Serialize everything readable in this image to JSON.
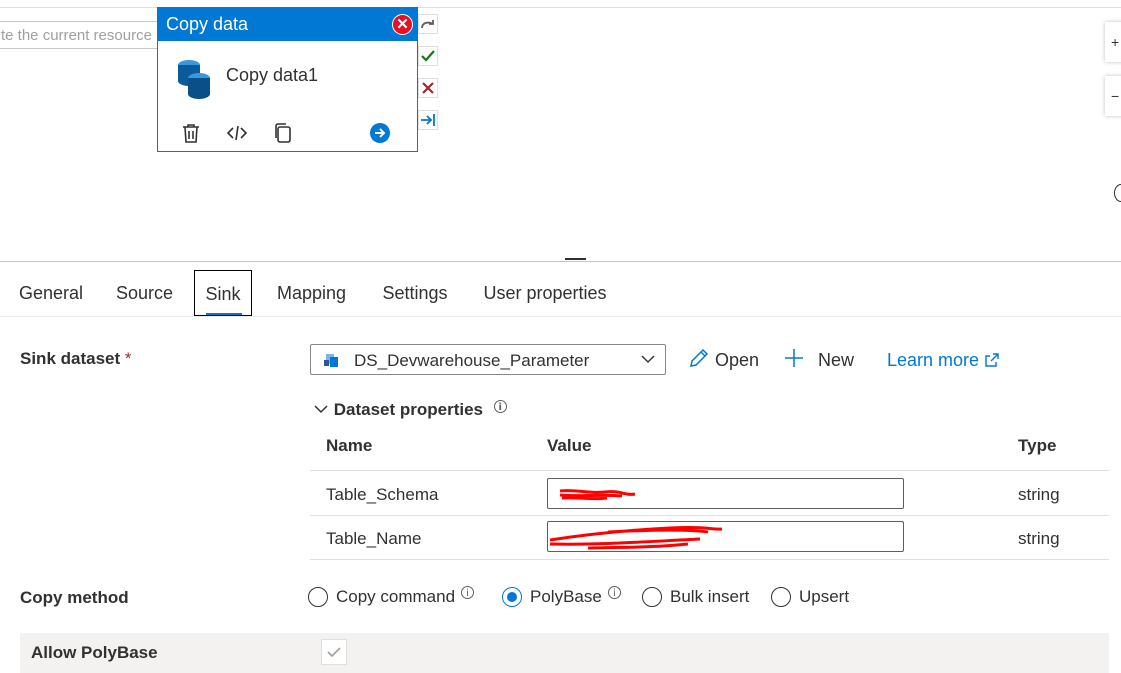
{
  "canvas": {
    "search_placeholder": "te the current resource",
    "activity": {
      "type_title": "Copy data",
      "name": "Copy data1"
    },
    "zoom_buttons": [
      "+",
      "−"
    ]
  },
  "tabs": [
    {
      "label": "General"
    },
    {
      "label": "Source"
    },
    {
      "label": "Sink",
      "active": true
    },
    {
      "label": "Mapping"
    },
    {
      "label": "Settings"
    },
    {
      "label": "User properties"
    }
  ],
  "sink": {
    "dataset_label": "Sink dataset",
    "required_mark": "*",
    "dataset_value": "DS_Devwarehouse_Parameter",
    "open_label": "Open",
    "new_label": "New",
    "learn_more_label": "Learn more",
    "dataset_properties": {
      "toggle_label": "Dataset properties",
      "headers": {
        "name": "Name",
        "value": "Value",
        "type": "Type"
      },
      "rows": [
        {
          "name": "Table_Schema",
          "value": "",
          "type": "string"
        },
        {
          "name": "Table_Name",
          "value": "",
          "type": "string"
        }
      ]
    },
    "copy_method": {
      "label": "Copy method",
      "options": [
        "Copy command",
        "PolyBase",
        "Bulk insert",
        "Upsert"
      ],
      "selected": "PolyBase"
    },
    "allow_polybase": {
      "label": "Allow PolyBase",
      "checked": true
    }
  },
  "colors": {
    "accent": "#0078d4",
    "close_red": "#e81123",
    "redaction": "#ff0000"
  }
}
